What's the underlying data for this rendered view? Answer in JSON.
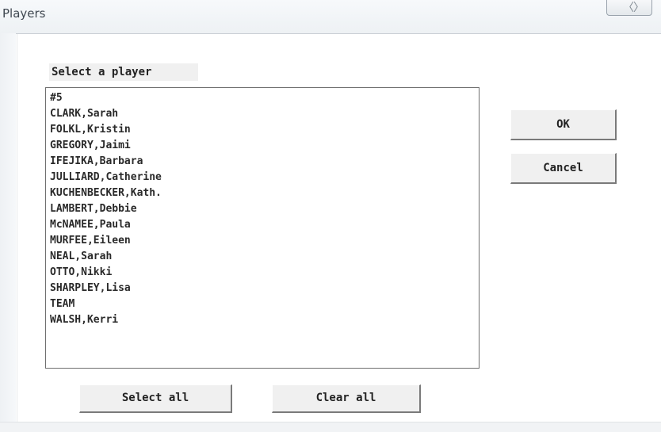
{
  "window": {
    "title": "Players",
    "close_glyph": "〈〉"
  },
  "dialog": {
    "prompt": "Select a player",
    "players": [
      "#5",
      "CLARK,Sarah",
      "FOLKL,Kristin",
      "GREGORY,Jaimi",
      "IFEJIKA,Barbara",
      "JULLIARD,Catherine",
      "KUCHENBECKER,Kath.",
      "LAMBERT,Debbie",
      "McNAMEE,Paula",
      "MURFEE,Eileen",
      "NEAL,Sarah",
      "OTTO,Nikki",
      "SHARPLEY,Lisa",
      "TEAM",
      "WALSH,Kerri"
    ],
    "ok_label": "OK",
    "cancel_label": "Cancel",
    "select_all_label": "Select all",
    "clear_all_label": "Clear all"
  },
  "colors": {
    "dialog_background": "#ffffff",
    "button_face": "#f0f0f0",
    "list_border": "#6f6f6f",
    "text": "#222222"
  }
}
